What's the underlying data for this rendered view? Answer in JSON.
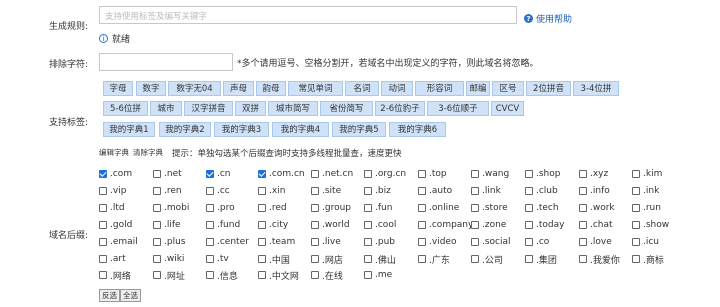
{
  "labels": {
    "rule": "生成规则:",
    "exclude": "排除字符:",
    "tags": "支持标签:",
    "suffix": "域名后缀:"
  },
  "rule_input": {
    "placeholder": "支持使用标签及编写关键字"
  },
  "help": {
    "label": "使用帮助",
    "icon": "help-circle-icon"
  },
  "info": {
    "label": "就绪",
    "icon": "info-icon"
  },
  "exclude_hint": "*多个请用逗号、空格分割开，若域名中出现定义的字符，则此域名将忽略。",
  "tags_row1": [
    "字母",
    "数字",
    "数字无04",
    "声母",
    "韵母",
    "常见单词",
    "名词",
    "动词",
    "形容词",
    "邮编",
    "区号",
    "2位拼音",
    "3-4位拼"
  ],
  "tags_row2": [
    "5-6位拼",
    "城市",
    "汉字拼音",
    "双拼",
    "城市简写",
    "省份简写",
    "2-6位豹子",
    "3-6位顺子",
    "CVCV"
  ],
  "tags_row3": [
    "我的字典1",
    "我的字典2",
    "我的字典3",
    "我的字典4",
    "我的字典5",
    "我的字典6"
  ],
  "dict_actions": {
    "edit": "编辑字典",
    "clear": "清除字典"
  },
  "tip": "提示：单独勾选某个后缀查询时支持多线程批量查，速度更快",
  "suffixes": [
    [
      ".com",
      ".net",
      ".cn",
      ".com.cn",
      ".net.cn",
      ".org.cn",
      ".top",
      ".wang",
      ".shop",
      ".xyz",
      ".kim"
    ],
    [
      ".vip",
      ".ren",
      ".cc",
      ".xin",
      ".site",
      ".biz",
      ".auto",
      ".link",
      ".club",
      ".info",
      ".ink"
    ],
    [
      ".ltd",
      ".mobi",
      ".pro",
      ".red",
      ".group",
      ".fun",
      ".online",
      ".store",
      ".tech",
      ".work",
      ".run"
    ],
    [
      ".gold",
      ".life",
      ".fund",
      ".city",
      ".world",
      ".cool",
      ".company",
      ".zone",
      ".today",
      ".chat",
      ".show"
    ],
    [
      ".email",
      ".plus",
      ".center",
      ".team",
      ".live",
      ".pub",
      ".video",
      ".social",
      ".co",
      ".love",
      ".icu"
    ],
    [
      ".art",
      ".wiki",
      ".tv",
      ".中国",
      ".网店",
      ".佛山",
      ".广东",
      ".公司",
      ".集团",
      ".我爱你",
      ".商标"
    ],
    [
      ".网络",
      ".网址",
      ".信息",
      ".中文网",
      ".在线",
      ".me"
    ]
  ],
  "checked": [
    ".com",
    ".cn",
    ".com.cn"
  ],
  "buttons": {
    "invert": "反选",
    "all": "全选"
  }
}
